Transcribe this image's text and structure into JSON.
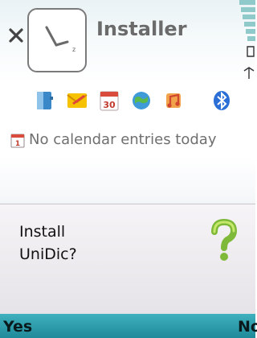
{
  "window": {
    "title": "Installer"
  },
  "toolbar": {
    "icons": [
      "contacts-icon",
      "messaging-icon",
      "calendar-icon",
      "web-icon",
      "music-icon",
      "bluetooth-icon"
    ],
    "calendar_day": "30"
  },
  "calendar": {
    "status_text": "No calendar entries today"
  },
  "dialog": {
    "line1": "Install",
    "line2": "UniDic?"
  },
  "softkeys": {
    "left": "Yes",
    "right": "No"
  },
  "colors": {
    "softkey_bar": "#2aa0ad",
    "dialog_bg": "#eeebf0",
    "question_mark": "#8cc63f"
  }
}
